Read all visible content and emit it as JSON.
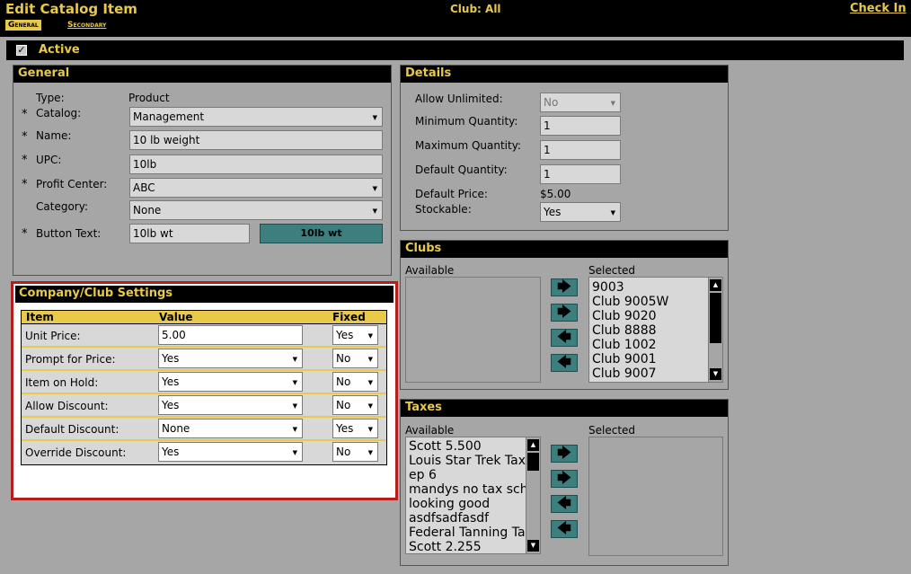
{
  "header": {
    "title": "Edit Catalog Item",
    "tabs": [
      {
        "label": "General"
      },
      {
        "label": "Secondary"
      }
    ],
    "club_text": "Club:  All",
    "checkin_label": "Check In"
  },
  "active": {
    "label": "Active",
    "checked": true,
    "check_glyph": "✓"
  },
  "general": {
    "title": "General",
    "type_label": "Type:",
    "type_value": "Product",
    "catalog_label": "Catalog:",
    "catalog_value": "Management",
    "name_label": "Name:",
    "name_value": "10 lb weight",
    "upc_label": "UPC:",
    "upc_value": "10lb",
    "profit_center_label": "Profit Center:",
    "profit_center_value": "ABC",
    "category_label": "Category:",
    "category_value": "None",
    "button_text_label": "Button Text:",
    "button_text_value": "10lb wt",
    "button_preview": "10lb wt",
    "required_mark": "*"
  },
  "details": {
    "title": "Details",
    "allow_unlimited_label": "Allow Unlimited:",
    "allow_unlimited_value": "No",
    "min_qty_label": "Minimum Quantity:",
    "min_qty_value": "1",
    "max_qty_label": "Maximum Quantity:",
    "max_qty_value": "1",
    "default_qty_label": "Default Quantity:",
    "default_qty_value": "1",
    "default_price_label": "Default Price:",
    "default_price_value": "$5.00",
    "stockable_label": "Stockable:",
    "stockable_value": "Yes"
  },
  "company": {
    "title": "Company/Club Settings",
    "headers": {
      "item": "Item",
      "value": "Value",
      "fixed": "Fixed"
    },
    "rows": [
      {
        "item": "Unit Price:",
        "value": "5.00",
        "fixed": "Yes"
      },
      {
        "item": "Prompt for Price:",
        "value": "Yes",
        "fixed": "No"
      },
      {
        "item": "Item on Hold:",
        "value": "Yes",
        "fixed": "No"
      },
      {
        "item": "Allow Discount:",
        "value": "Yes",
        "fixed": "No"
      },
      {
        "item": "Default Discount:",
        "value": "None",
        "fixed": "Yes"
      },
      {
        "item": "Override Discount:",
        "value": "Yes",
        "fixed": "No"
      }
    ]
  },
  "clubs": {
    "title": "Clubs",
    "available_label": "Available",
    "selected_label": "Selected",
    "selected_items": [
      "9003",
      "Club 9005W",
      "Club 9020",
      "Club 8888",
      "Club 1002",
      "Club 9001",
      "Club 9007"
    ]
  },
  "taxes": {
    "title": "Taxes",
    "available_label": "Available",
    "selected_label": "Selected",
    "available_items": [
      "Scott 5.500",
      "Louis Star Trek Tax",
      "ep 6",
      "mandys no tax scho",
      "looking good",
      "asdfsadfasdf",
      "Federal Tanning Ta",
      "Scott 2.255"
    ]
  },
  "icons": {
    "right": "🡆",
    "left": "🡄",
    "up": "▲",
    "down": "▼"
  },
  "colors": {
    "accent": "#e8c94a",
    "highlight_border": "#b81d1d",
    "button": "#3d7e7e",
    "background": "#a6a6a6"
  }
}
